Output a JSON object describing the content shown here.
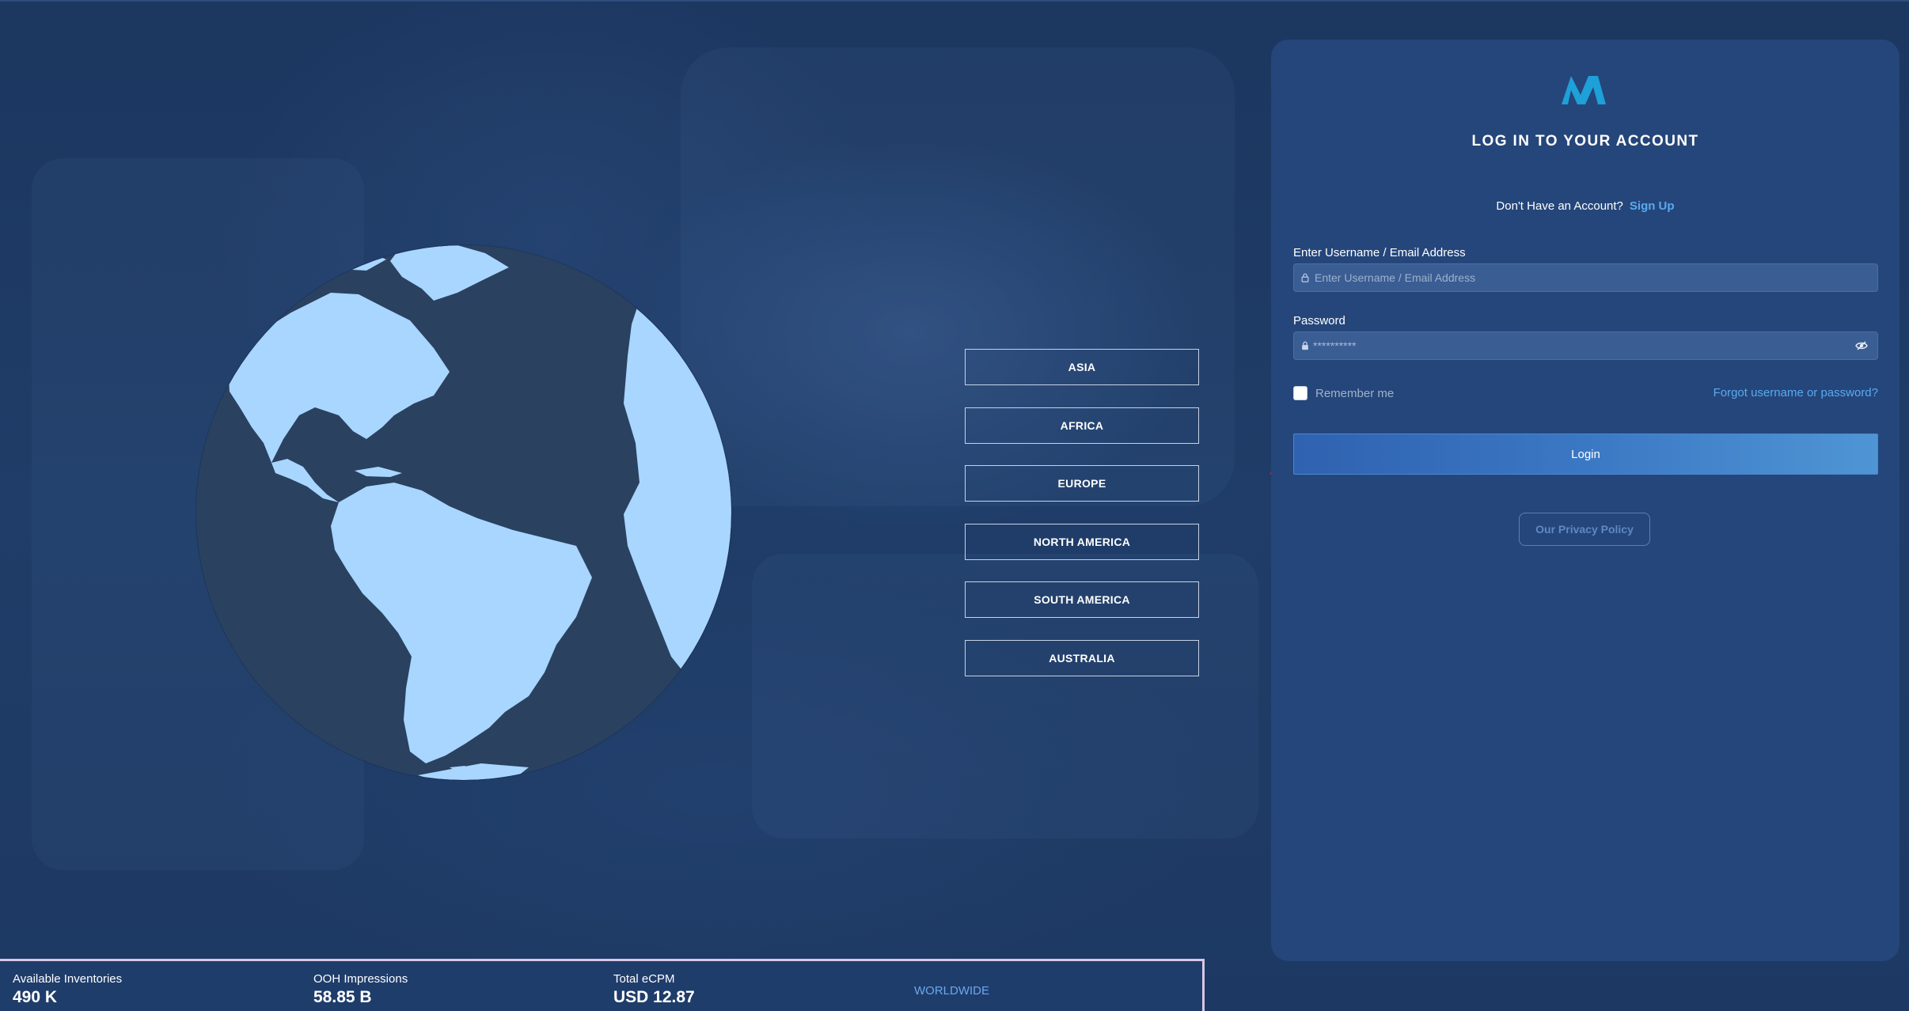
{
  "continents": [
    "ASIA",
    "AFRICA",
    "EUROPE",
    "NORTH AMERICA",
    "SOUTH AMERICA",
    "AUSTRALIA"
  ],
  "login": {
    "title": "LOG IN TO YOUR ACCOUNT",
    "no_account_text": "Don't Have an Account?",
    "signup_label": "Sign Up",
    "username_label": "Enter Username / Email Address",
    "username_placeholder": "Enter Username / Email Address",
    "password_label": "Password",
    "password_value": "**********",
    "remember_label": "Remember me",
    "forgot_label": "Forgot username or password?",
    "login_label": "Login",
    "privacy_label": "Our Privacy Policy"
  },
  "icons": {
    "logo": "brand-logo",
    "username": "user-lock-icon",
    "password": "lock-icon",
    "toggle": "eye-icon"
  },
  "stats": [
    {
      "label": "Available Inventories",
      "value": "490 K"
    },
    {
      "label": "OOH Impressions",
      "value": "58.85 B"
    },
    {
      "label": "Total eCPM",
      "value": "USD 12.87"
    }
  ],
  "region_label": "WORLDWIDE",
  "colors": {
    "background": "#1e3a64",
    "panel": "#25467a",
    "accent": "#5aa9f0",
    "land": "#a8d6ff",
    "ocean": "#2a4160",
    "logo": "#1ea0d8"
  }
}
